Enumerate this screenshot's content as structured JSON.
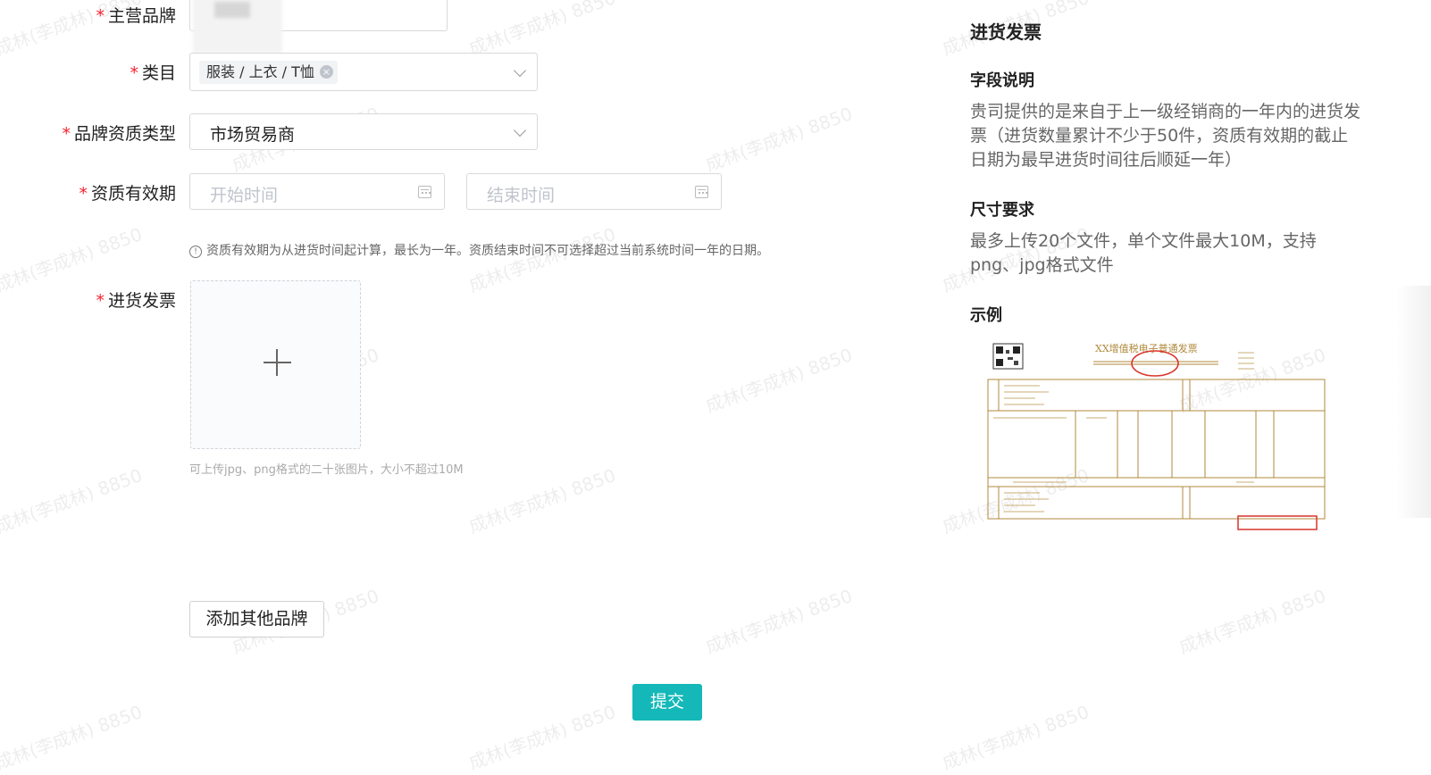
{
  "form": {
    "brand": {
      "label": "主营品牌",
      "required_mark": "*"
    },
    "category": {
      "label": "类目",
      "required_mark": "*",
      "tag": "服装 / 上衣 / T恤",
      "tag_close": "×"
    },
    "qualification_type": {
      "label": "品牌资质类型",
      "required_mark": "*",
      "value": "市场贸易商"
    },
    "validity": {
      "label": "资质有效期",
      "required_mark": "*",
      "start_placeholder": "开始时间",
      "end_placeholder": "结束时间",
      "hint": "资质有效期为从进货时间起计算，最长为一年。资质结束时间不可选择超过当前系统时间一年的日期。"
    },
    "invoice": {
      "label": "进货发票",
      "required_mark": "*",
      "upload_hint": "可上传jpg、png格式的二十张图片，大小不超过10M"
    },
    "add_brand_button": "添加其他品牌",
    "submit_button": "提交"
  },
  "side_panel": {
    "title": "进货发票",
    "field_desc_title": "字段说明",
    "field_desc": "贵司提供的是来自于上一级经销商的一年内的进货发票（进货数量累计不少于50件，资质有效期的截止日期为最早进货时间往后顺延一年）",
    "size_title": "尺寸要求",
    "size_desc": "最多上传20个文件，单个文件最大10M，支持png、jpg格式文件",
    "example_title": "示例",
    "example_invoice_title": "XX增值税电子普通发票"
  },
  "watermark": "成林(李成林) 8850",
  "colors": {
    "primary": "#14b8b8",
    "required": "#f5222d",
    "invoice_line": "#b08a3c",
    "invoice_stamp": "#d9342b"
  }
}
